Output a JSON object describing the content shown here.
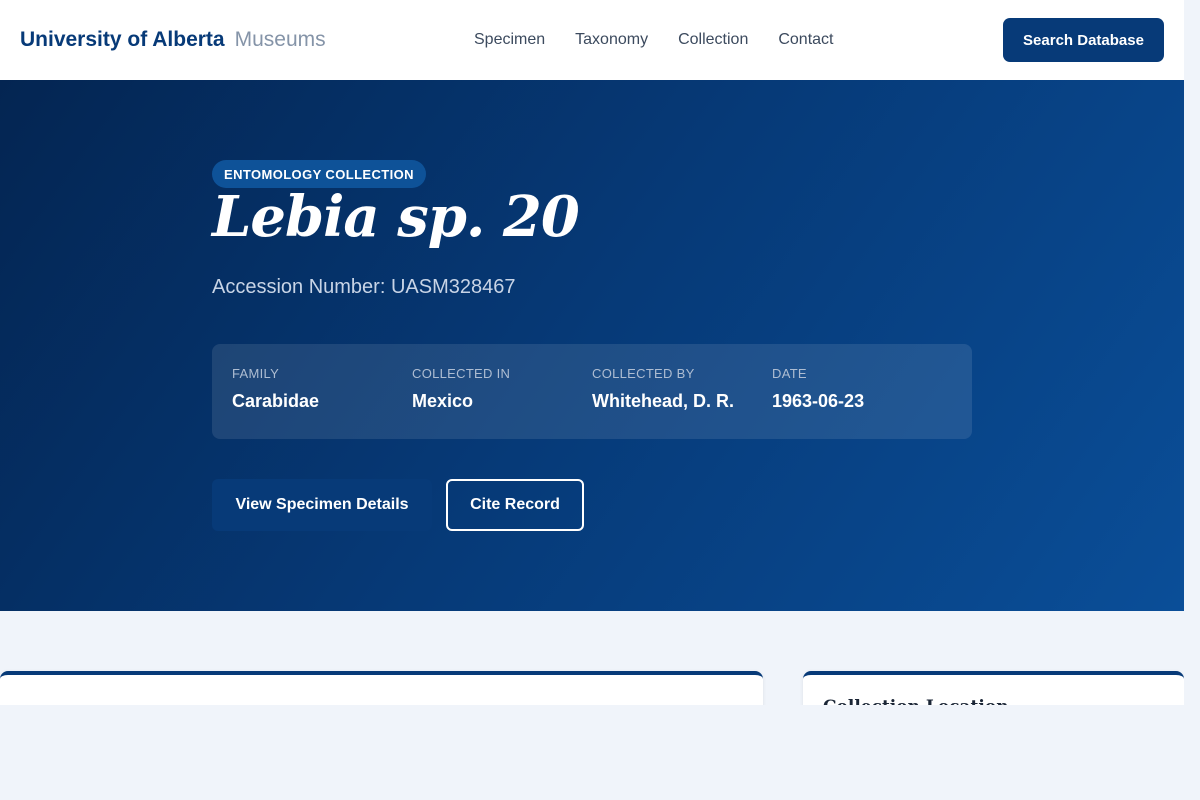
{
  "header": {
    "brand_name": "University of Alberta",
    "brand_sub": "Museums",
    "nav": [
      "Specimen",
      "Taxonomy",
      "Collection",
      "Contact"
    ],
    "search_button": "Search Database"
  },
  "hero": {
    "badge": "ENTOMOLOGY COLLECTION",
    "title": "Lebia sp. 20",
    "accession": "Accession Number: UASM328467",
    "meta": [
      {
        "label": "FAMILY",
        "value": "Carabidae"
      },
      {
        "label": "COLLECTED IN",
        "value": "Mexico"
      },
      {
        "label": "COLLECTED BY",
        "value": "Whitehead, D. R."
      },
      {
        "label": "DATE",
        "value": "1963-06-23"
      }
    ],
    "details_button": "View Specimen Details",
    "cite_button": "Cite Record"
  },
  "content": {
    "side_card_title": "Collection Location"
  },
  "colors": {
    "primary": "#073a78",
    "hero_start": "#042552",
    "hero_end": "#0a4e98",
    "page_bg": "#f0f4fa"
  }
}
